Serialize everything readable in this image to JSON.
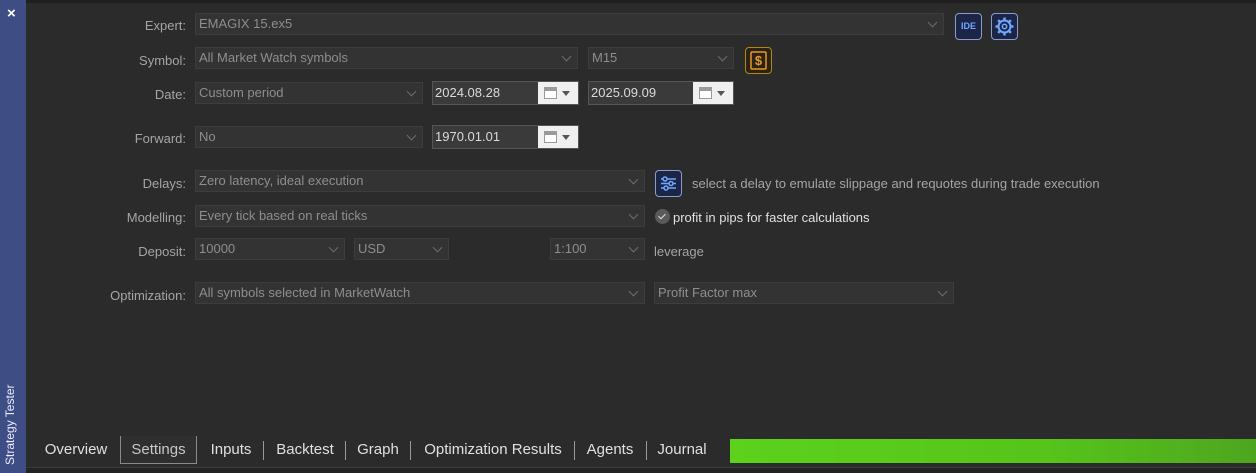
{
  "panel": {
    "close_glyph": "×",
    "side_title": "Strategy Tester",
    "accent": "#3f4d85"
  },
  "form": {
    "expert_label": "Expert:",
    "expert_value": "EMAGIX 15.ex5",
    "ide_label": "IDE",
    "symbol_label": "Symbol:",
    "symbol_value": "All Market Watch symbols",
    "timeframe_value": "M15",
    "date_label": "Date:",
    "date_mode": "Custom period",
    "date_from": "2024.08.28",
    "date_to": "2025.09.09",
    "forward_label": "Forward:",
    "forward_value": "No",
    "forward_date": "1970.01.01",
    "delays_label": "Delays:",
    "delays_value": "Zero latency, ideal execution",
    "delays_note": "select a delay to emulate slippage and requotes during trade execution",
    "modelling_label": "Modelling:",
    "modelling_value": "Every tick based on real ticks",
    "profit_pips_label": "profit in pips for faster calculations",
    "profit_pips_checked": true,
    "deposit_label": "Deposit:",
    "deposit_value": "10000",
    "currency_value": "USD",
    "leverage_value": "1:100",
    "leverage_label": "leverage",
    "optimization_label": "Optimization:",
    "optimization_value": "All symbols selected in MarketWatch",
    "criterion_value": "Profit Factor max"
  },
  "tabs": [
    "Overview",
    "Settings",
    "Inputs",
    "Backtest",
    "Graph",
    "Optimization Results",
    "Agents",
    "Journal"
  ],
  "active_tab": "Settings",
  "progress": {
    "fraction": 1.0,
    "color": "#5cd21c"
  }
}
